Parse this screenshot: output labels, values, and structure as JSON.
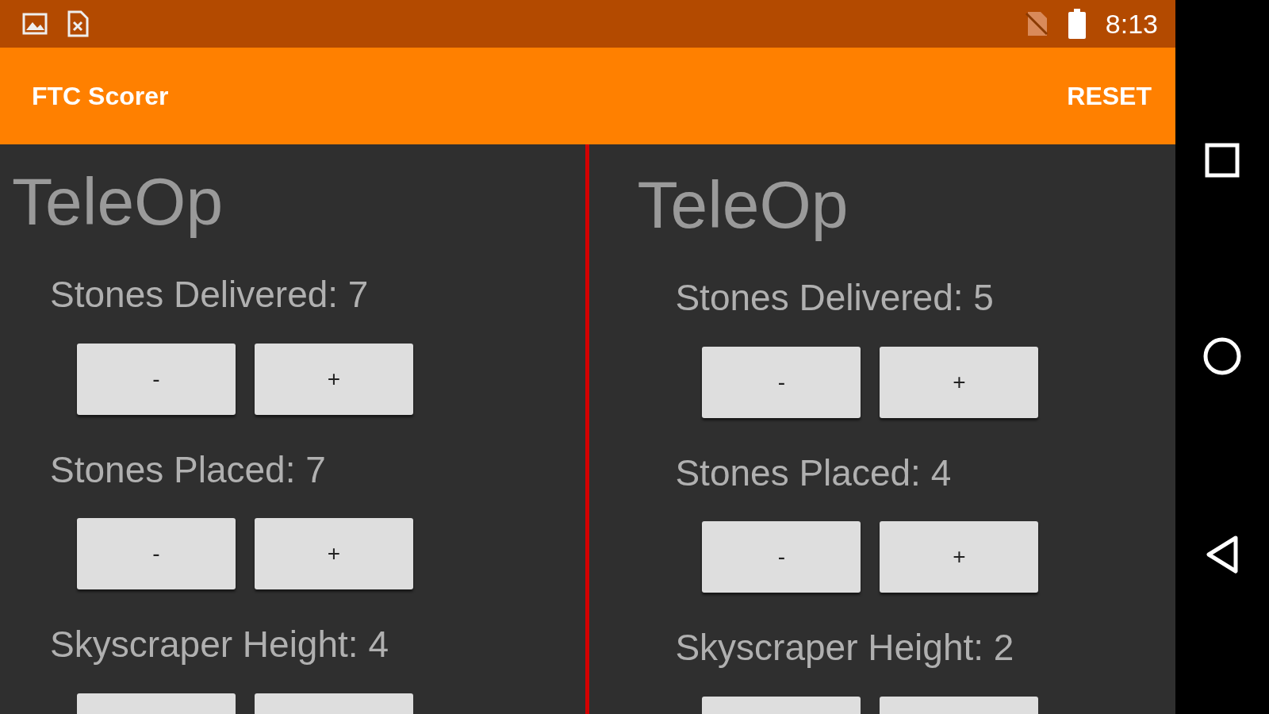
{
  "status_bar": {
    "time": "8:13"
  },
  "app_bar": {
    "title": "FTC Scorer",
    "action": "RESET"
  },
  "panels": [
    {
      "title": "TeleOp",
      "counters": [
        {
          "label": "Stones Delivered: 7",
          "buttons": [
            "-",
            "+"
          ]
        },
        {
          "label": "Stones Placed: 7",
          "buttons": [
            "-",
            "+"
          ]
        },
        {
          "label": "Skyscraper Height: 4",
          "controls_cut": true
        }
      ]
    },
    {
      "title": "TeleOp",
      "counters": [
        {
          "label": "Stones Delivered: 5",
          "buttons": [
            "-",
            "+"
          ]
        },
        {
          "label": "Stones Placed: 4",
          "buttons": [
            "-",
            "+"
          ]
        },
        {
          "label": "Skyscraper Height: 2",
          "controls_cut": true
        }
      ]
    }
  ]
}
